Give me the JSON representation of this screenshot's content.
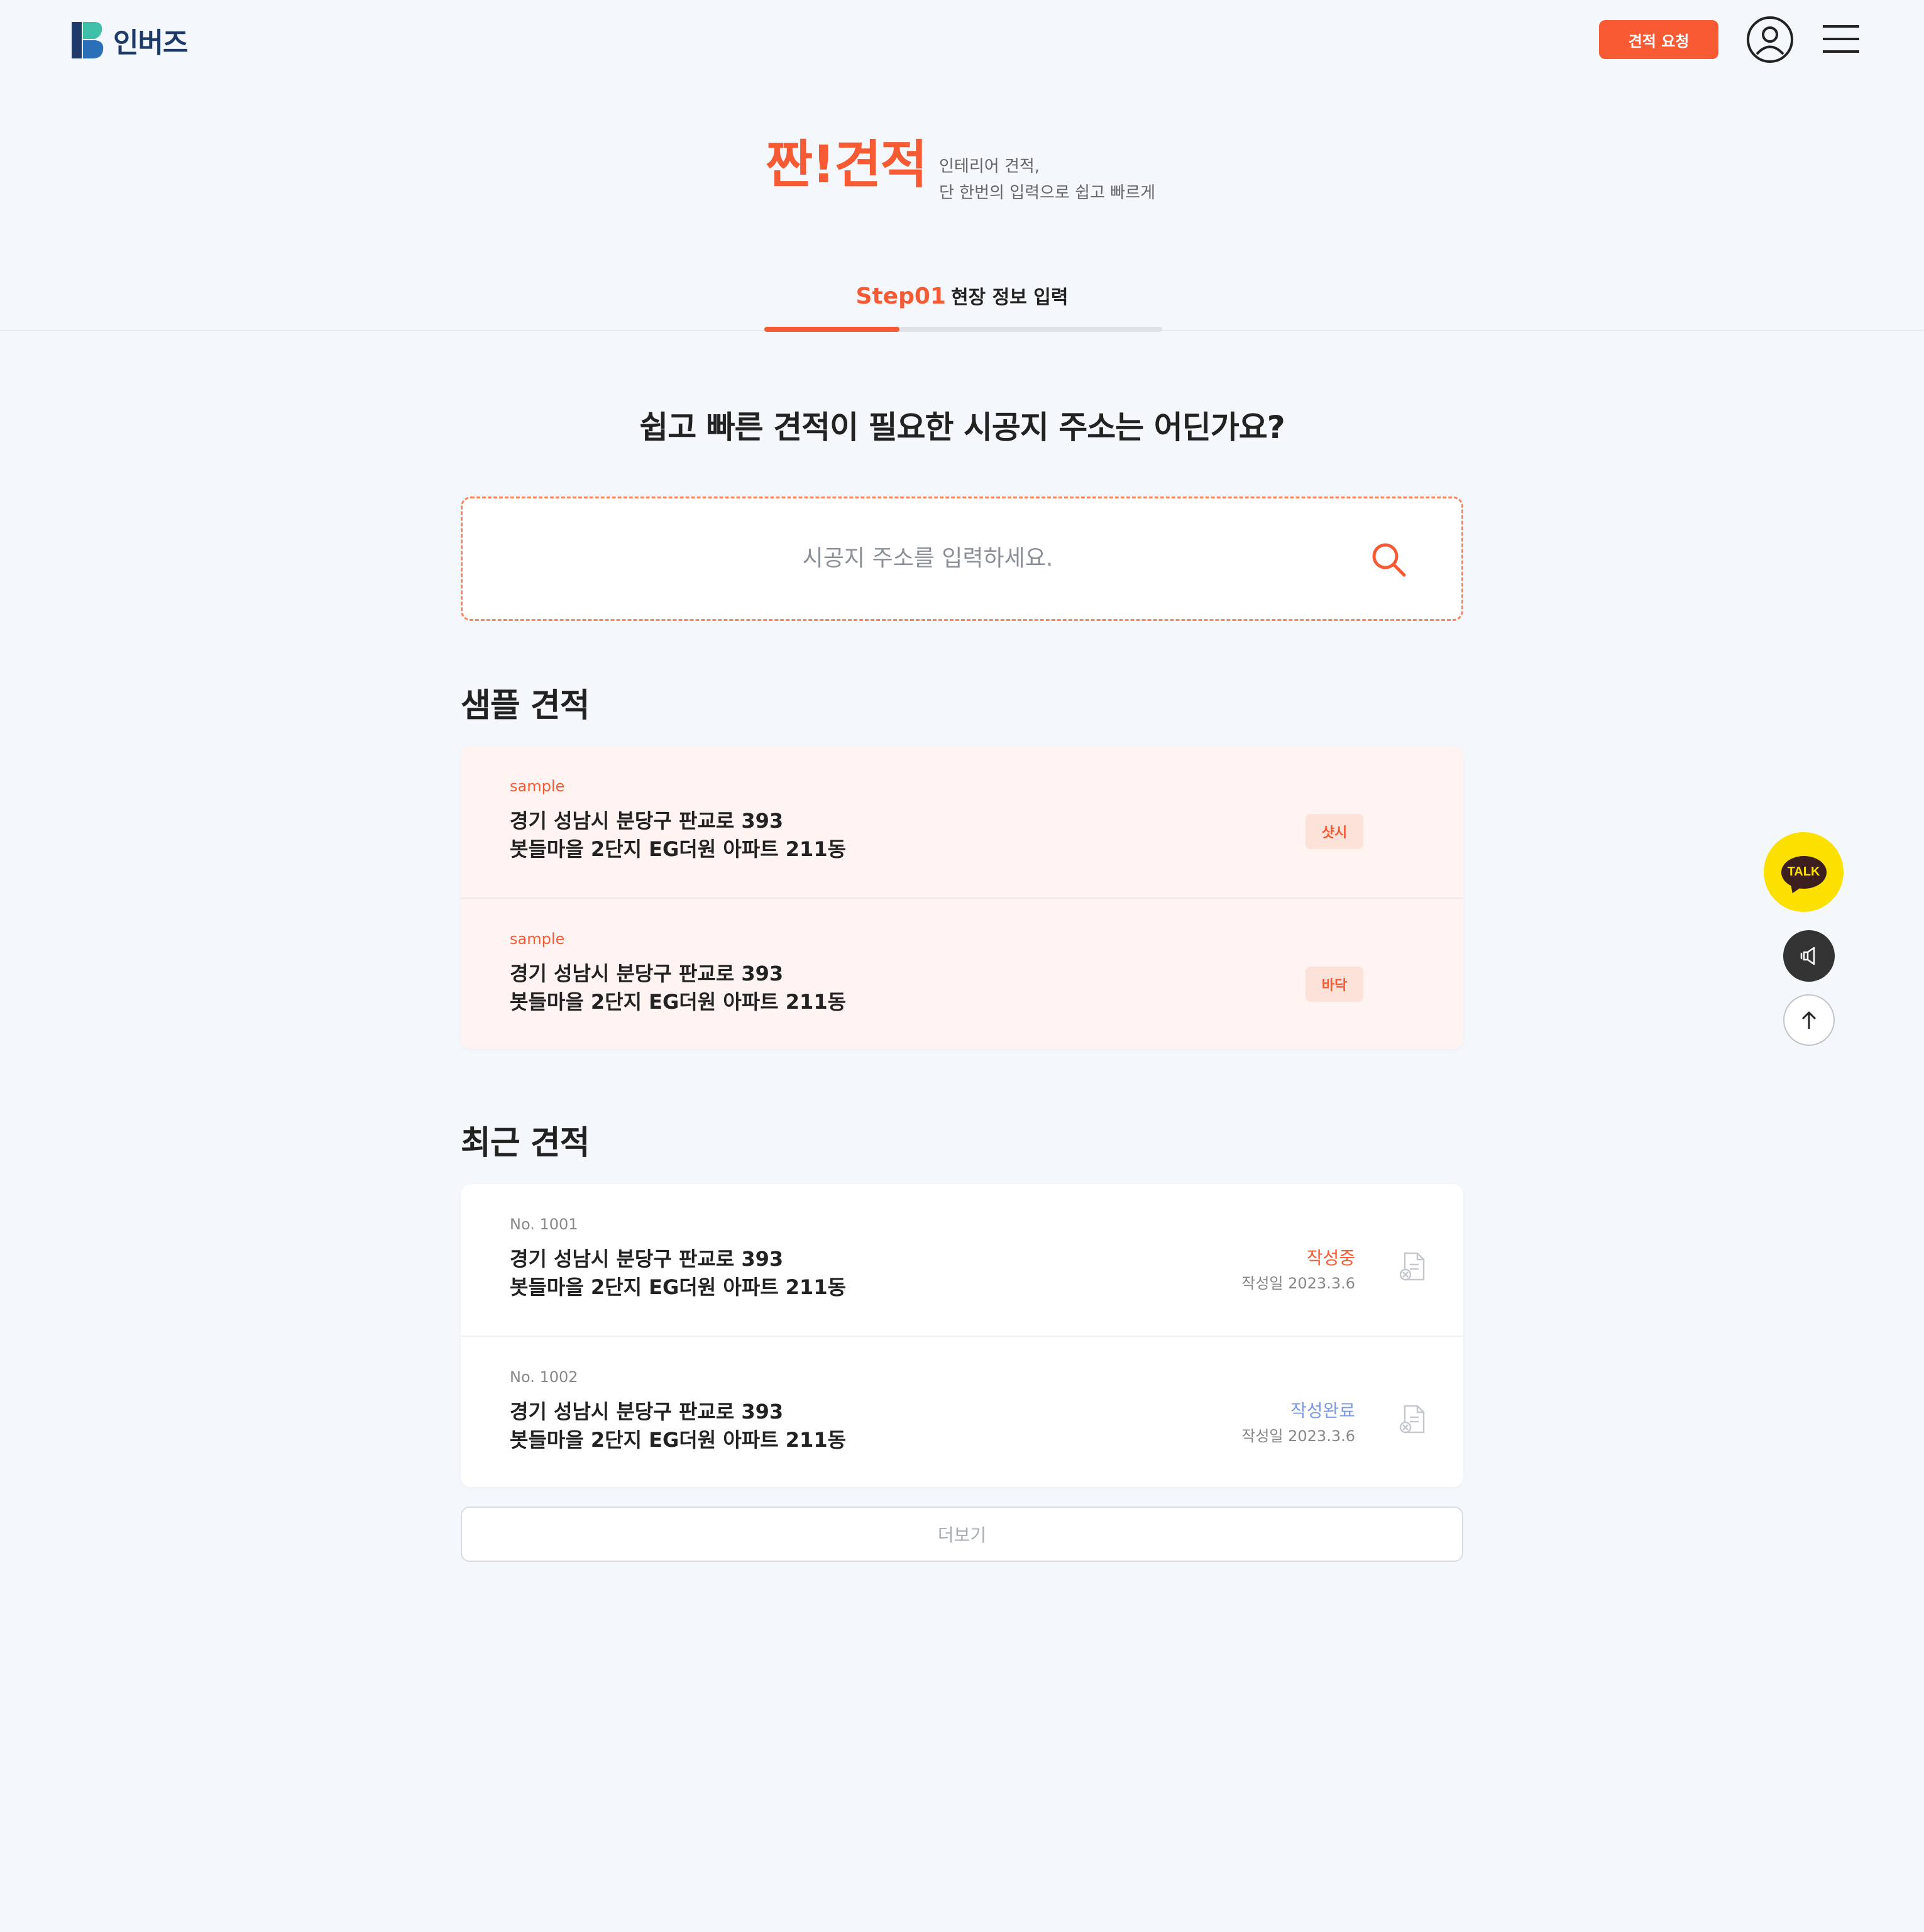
{
  "header": {
    "logo_text": "인버즈",
    "request_button": "견적 요청"
  },
  "hero": {
    "title": "짠!견적",
    "subtitle_line1": "인테리어 견적,",
    "subtitle_line2": "단 한번의 입력으로 쉽고 빠르게"
  },
  "step": {
    "number": "Step01",
    "label": "현장 정보 입력",
    "progress": 0.34
  },
  "question": "쉽고 빠른 견적이 필요한 시공지 주소는 어딘가요?",
  "search": {
    "placeholder": "시공지 주소를 입력하세요.",
    "value": ""
  },
  "sample_section": {
    "title": "샘플 견적",
    "items": [
      {
        "tag": "sample",
        "address_line1": "경기 성남시 분당구 판교로 393",
        "address_line2": "봇들마을 2단지 EG더원 아파트 211동",
        "badge": "샷시"
      },
      {
        "tag": "sample",
        "address_line1": "경기 성남시 분당구 판교로 393",
        "address_line2": "봇들마을 2단지 EG더원 아파트 211동",
        "badge": "바닥"
      }
    ]
  },
  "recent_section": {
    "title": "최근 견적",
    "items": [
      {
        "no": "No. 1001",
        "address_line1": "경기 성남시 분당구 판교로 393",
        "address_line2": "봇들마을 2단지 EG더원 아파트 211동",
        "status": "작성중",
        "status_color": "#f85a34",
        "date": "작성일 2023.3.6"
      },
      {
        "no": "No. 1002",
        "address_line1": "경기 성남시 분당구 판교로 393",
        "address_line2": "봇들마을 2단지 EG더원 아파트 211동",
        "status": "작성완료",
        "status_color": "#7b9be6",
        "date": "작성일 2023.3.6"
      }
    ],
    "more_button": "더보기"
  },
  "floating": {
    "talk_label": "TALK"
  },
  "colors": {
    "accent": "#f85a34",
    "background": "#f4f7fb",
    "talk_yellow": "#fce100"
  }
}
